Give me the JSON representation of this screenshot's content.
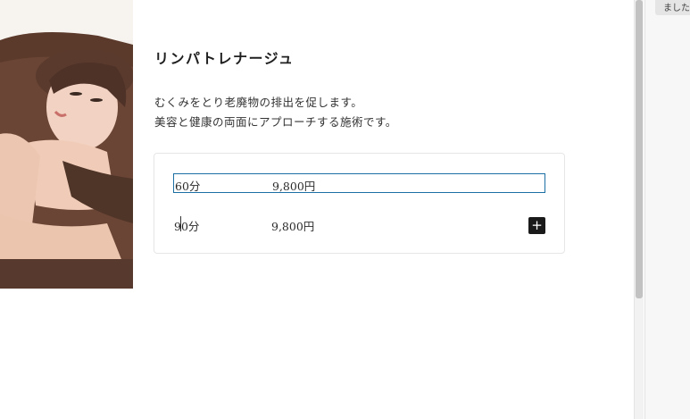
{
  "service": {
    "title": "リンパトレナージュ",
    "description_lines": [
      "むくみをとり老廃物の排出を促します。",
      "美容と健康の両面にアプローチする施術です。"
    ]
  },
  "prices": [
    {
      "duration": "60分",
      "price": "9,800円"
    },
    {
      "duration": "90分",
      "price": "9,800円"
    }
  ],
  "add_button": {
    "icon": "plus-icon",
    "label": "+"
  },
  "side_panel": {
    "chip_text": "ました"
  },
  "photo": {
    "subject": "massage-photo"
  },
  "colors": {
    "focus_border": "#1b6fa3",
    "add_button_bg": "#1a1a1a"
  }
}
